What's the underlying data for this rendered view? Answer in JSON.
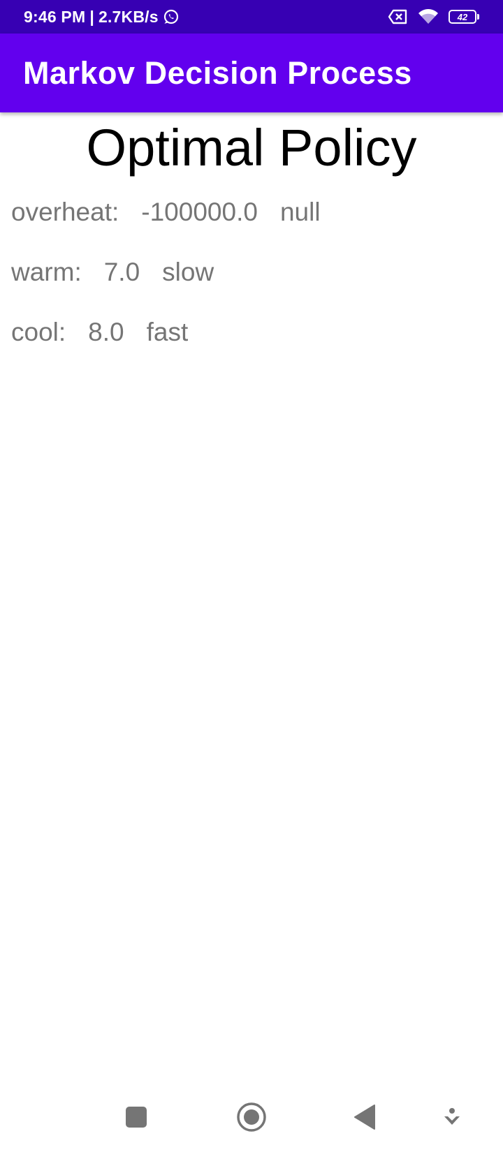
{
  "status_bar": {
    "time": "9:46 PM",
    "separator": "|",
    "network_speed": "2.7KB/s",
    "battery_level": "42",
    "icons": [
      "whatsapp-icon",
      "sim-blocked-icon",
      "wifi-icon",
      "battery-icon"
    ],
    "background_color": "#3700b3"
  },
  "app_bar": {
    "title": "Markov Decision Process",
    "background_color": "#6200ee"
  },
  "main": {
    "page_title": "Optimal Policy",
    "policies": [
      {
        "state": "overheat:",
        "value": "-100000.0",
        "action": "null"
      },
      {
        "state": "warm:",
        "value": "7.0",
        "action": "slow"
      },
      {
        "state": "cool:",
        "value": "8.0",
        "action": "fast"
      }
    ]
  },
  "nav_bar": {
    "buttons": [
      "recents-square-icon",
      "home-circle-icon",
      "back-triangle-icon",
      "assistant-down-icon"
    ]
  }
}
